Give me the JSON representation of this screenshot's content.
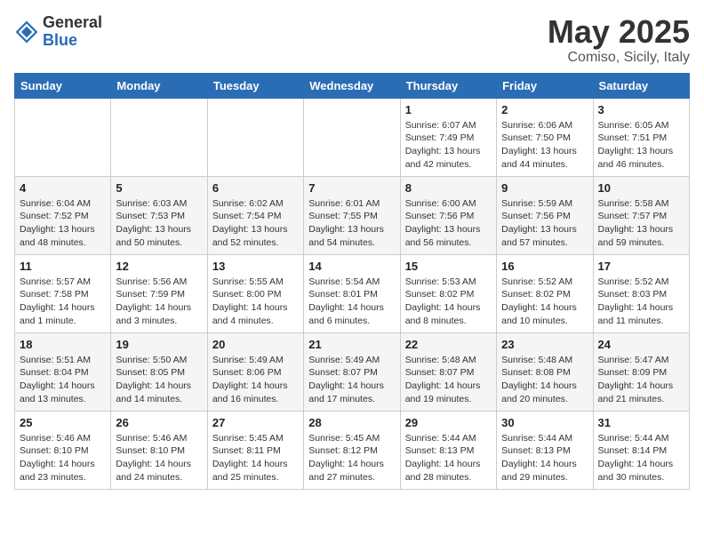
{
  "header": {
    "logo_general": "General",
    "logo_blue": "Blue",
    "month_title": "May 2025",
    "location": "Comiso, Sicily, Italy"
  },
  "weekdays": [
    "Sunday",
    "Monday",
    "Tuesday",
    "Wednesday",
    "Thursday",
    "Friday",
    "Saturday"
  ],
  "weeks": [
    [
      {
        "day": "",
        "info": ""
      },
      {
        "day": "",
        "info": ""
      },
      {
        "day": "",
        "info": ""
      },
      {
        "day": "",
        "info": ""
      },
      {
        "day": "1",
        "info": "Sunrise: 6:07 AM\nSunset: 7:49 PM\nDaylight: 13 hours\nand 42 minutes."
      },
      {
        "day": "2",
        "info": "Sunrise: 6:06 AM\nSunset: 7:50 PM\nDaylight: 13 hours\nand 44 minutes."
      },
      {
        "day": "3",
        "info": "Sunrise: 6:05 AM\nSunset: 7:51 PM\nDaylight: 13 hours\nand 46 minutes."
      }
    ],
    [
      {
        "day": "4",
        "info": "Sunrise: 6:04 AM\nSunset: 7:52 PM\nDaylight: 13 hours\nand 48 minutes."
      },
      {
        "day": "5",
        "info": "Sunrise: 6:03 AM\nSunset: 7:53 PM\nDaylight: 13 hours\nand 50 minutes."
      },
      {
        "day": "6",
        "info": "Sunrise: 6:02 AM\nSunset: 7:54 PM\nDaylight: 13 hours\nand 52 minutes."
      },
      {
        "day": "7",
        "info": "Sunrise: 6:01 AM\nSunset: 7:55 PM\nDaylight: 13 hours\nand 54 minutes."
      },
      {
        "day": "8",
        "info": "Sunrise: 6:00 AM\nSunset: 7:56 PM\nDaylight: 13 hours\nand 56 minutes."
      },
      {
        "day": "9",
        "info": "Sunrise: 5:59 AM\nSunset: 7:56 PM\nDaylight: 13 hours\nand 57 minutes."
      },
      {
        "day": "10",
        "info": "Sunrise: 5:58 AM\nSunset: 7:57 PM\nDaylight: 13 hours\nand 59 minutes."
      }
    ],
    [
      {
        "day": "11",
        "info": "Sunrise: 5:57 AM\nSunset: 7:58 PM\nDaylight: 14 hours\nand 1 minute."
      },
      {
        "day": "12",
        "info": "Sunrise: 5:56 AM\nSunset: 7:59 PM\nDaylight: 14 hours\nand 3 minutes."
      },
      {
        "day": "13",
        "info": "Sunrise: 5:55 AM\nSunset: 8:00 PM\nDaylight: 14 hours\nand 4 minutes."
      },
      {
        "day": "14",
        "info": "Sunrise: 5:54 AM\nSunset: 8:01 PM\nDaylight: 14 hours\nand 6 minutes."
      },
      {
        "day": "15",
        "info": "Sunrise: 5:53 AM\nSunset: 8:02 PM\nDaylight: 14 hours\nand 8 minutes."
      },
      {
        "day": "16",
        "info": "Sunrise: 5:52 AM\nSunset: 8:02 PM\nDaylight: 14 hours\nand 10 minutes."
      },
      {
        "day": "17",
        "info": "Sunrise: 5:52 AM\nSunset: 8:03 PM\nDaylight: 14 hours\nand 11 minutes."
      }
    ],
    [
      {
        "day": "18",
        "info": "Sunrise: 5:51 AM\nSunset: 8:04 PM\nDaylight: 14 hours\nand 13 minutes."
      },
      {
        "day": "19",
        "info": "Sunrise: 5:50 AM\nSunset: 8:05 PM\nDaylight: 14 hours\nand 14 minutes."
      },
      {
        "day": "20",
        "info": "Sunrise: 5:49 AM\nSunset: 8:06 PM\nDaylight: 14 hours\nand 16 minutes."
      },
      {
        "day": "21",
        "info": "Sunrise: 5:49 AM\nSunset: 8:07 PM\nDaylight: 14 hours\nand 17 minutes."
      },
      {
        "day": "22",
        "info": "Sunrise: 5:48 AM\nSunset: 8:07 PM\nDaylight: 14 hours\nand 19 minutes."
      },
      {
        "day": "23",
        "info": "Sunrise: 5:48 AM\nSunset: 8:08 PM\nDaylight: 14 hours\nand 20 minutes."
      },
      {
        "day": "24",
        "info": "Sunrise: 5:47 AM\nSunset: 8:09 PM\nDaylight: 14 hours\nand 21 minutes."
      }
    ],
    [
      {
        "day": "25",
        "info": "Sunrise: 5:46 AM\nSunset: 8:10 PM\nDaylight: 14 hours\nand 23 minutes."
      },
      {
        "day": "26",
        "info": "Sunrise: 5:46 AM\nSunset: 8:10 PM\nDaylight: 14 hours\nand 24 minutes."
      },
      {
        "day": "27",
        "info": "Sunrise: 5:45 AM\nSunset: 8:11 PM\nDaylight: 14 hours\nand 25 minutes."
      },
      {
        "day": "28",
        "info": "Sunrise: 5:45 AM\nSunset: 8:12 PM\nDaylight: 14 hours\nand 27 minutes."
      },
      {
        "day": "29",
        "info": "Sunrise: 5:44 AM\nSunset: 8:13 PM\nDaylight: 14 hours\nand 28 minutes."
      },
      {
        "day": "30",
        "info": "Sunrise: 5:44 AM\nSunset: 8:13 PM\nDaylight: 14 hours\nand 29 minutes."
      },
      {
        "day": "31",
        "info": "Sunrise: 5:44 AM\nSunset: 8:14 PM\nDaylight: 14 hours\nand 30 minutes."
      }
    ]
  ]
}
